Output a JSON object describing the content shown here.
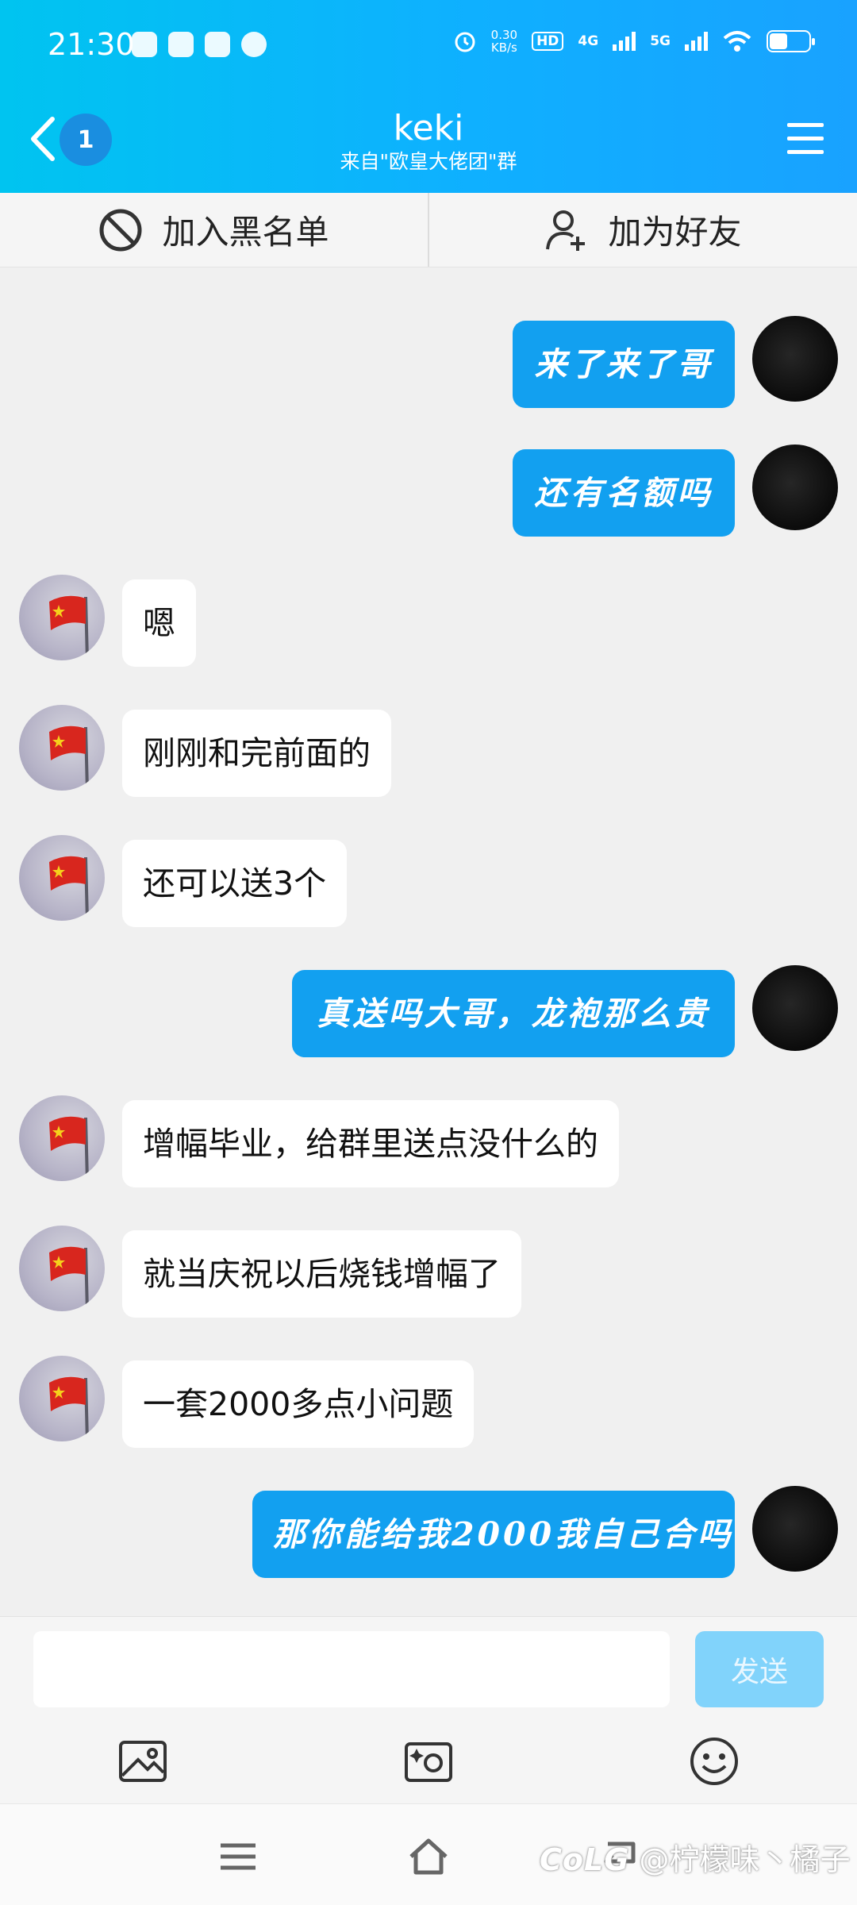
{
  "status_bar": {
    "time": "21:30",
    "net_speed_value": "0.30",
    "net_speed_unit": "KB/s",
    "hd_label": "HD",
    "signal_1": "4G",
    "signal_2": "5G"
  },
  "header": {
    "unread_count": "1",
    "title": "keki",
    "subtitle": "来自\"欧皇大佬团\"群"
  },
  "actions": {
    "blacklist_label": "加入黑名单",
    "add_friend_label": "加为好友"
  },
  "messages": [
    {
      "from": "self",
      "text": "来了来了哥"
    },
    {
      "from": "self",
      "text": "还有名额吗"
    },
    {
      "from": "other",
      "text": "嗯"
    },
    {
      "from": "other",
      "text": "刚刚和完前面的"
    },
    {
      "from": "other",
      "text": "还可以送3个"
    },
    {
      "from": "self",
      "text": "真送吗大哥，龙袍那么贵"
    },
    {
      "from": "other",
      "text": "增幅毕业，给群里送点没什么的"
    },
    {
      "from": "other",
      "text": "就当庆祝以后烧钱增幅了"
    },
    {
      "from": "other",
      "text": "一套2000多点小问题"
    },
    {
      "from": "self",
      "text": "那你能给我2000我自己合吗"
    }
  ],
  "composer": {
    "input_value": "",
    "send_label": "发送",
    "tools": [
      "image-icon",
      "camera-icon",
      "emoji-icon"
    ]
  },
  "navbar": {
    "buttons": [
      "menu-icon",
      "home-icon",
      "back-icon"
    ]
  },
  "watermark": {
    "brand": "CoLG",
    "user": "@柠檬味丶橘子"
  },
  "colors": {
    "header_start": "#00c4f0",
    "header_end": "#19a2ff",
    "outgoing_bubble": "#12a0f0",
    "incoming_bubble": "#ffffff",
    "send_button_disabled": "#81d3fb"
  }
}
